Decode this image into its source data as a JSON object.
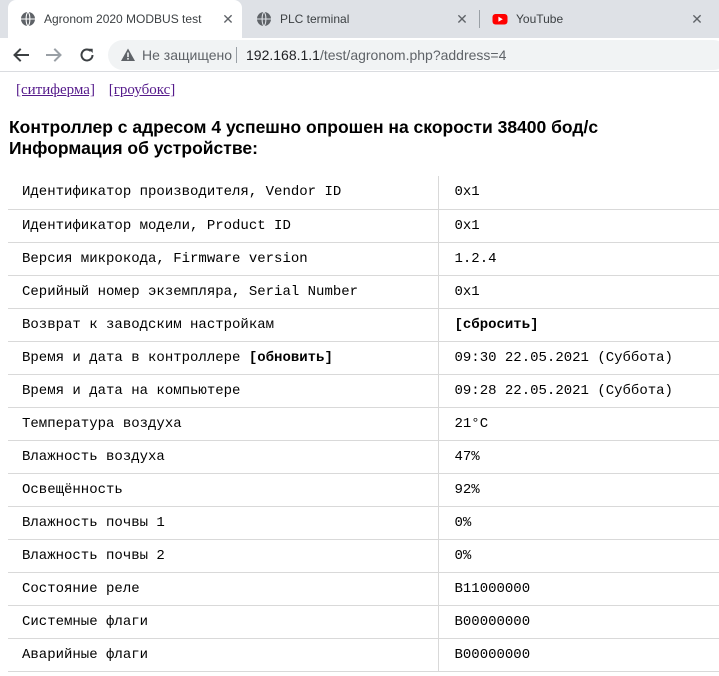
{
  "tabs": [
    {
      "title": "Agronom 2020 MODBUS test",
      "favicon": "globe-icon",
      "active": true
    },
    {
      "title": "PLC terminal",
      "favicon": "globe-icon",
      "active": false
    },
    {
      "title": "YouTube",
      "favicon": "youtube-icon",
      "active": false
    }
  ],
  "toolbar": {
    "security_label": "Не защищено",
    "url_host": "192.168.1.1",
    "url_path": "/test/agronom.php?address=4"
  },
  "nav_links": [
    "[ситиферма]",
    "[гроубокс]"
  ],
  "heading": {
    "line1": "Контроллер с адресом 4 успешно опрошен на скорости 38400 бод/с",
    "line2": "Информация об устройстве:"
  },
  "rows": [
    {
      "label": "Идентификатор производителя, Vendor ID",
      "value": "0x1"
    },
    {
      "label": "Идентификатор модели, Product ID",
      "value": "0x1"
    },
    {
      "label": "Версия микрокода, Firmware version",
      "value": "1.2.4"
    },
    {
      "label": "Серийный номер экземпляра, Serial Number",
      "value": "0x1"
    },
    {
      "label": "Возврат к заводским настройкам",
      "value": "[сбросить]"
    },
    {
      "label": "Время и дата в контроллере",
      "label_action": "[обновить]",
      "value": "09:30 22.05.2021 (Суббота)"
    },
    {
      "label": "Время и дата на компьютере",
      "value": "09:28 22.05.2021 (Суббота)"
    },
    {
      "label": "Температура воздуха",
      "value": "21°C"
    },
    {
      "label": "Влажность воздуха",
      "value": "47%"
    },
    {
      "label": "Освещённость",
      "value": "92%"
    },
    {
      "label": "Влажность почвы 1",
      "value": "0%"
    },
    {
      "label": "Влажность почвы 2",
      "value": "0%"
    },
    {
      "label": "Состояние реле",
      "value": "B11000000"
    },
    {
      "label": "Системные флаги",
      "value": "B00000000"
    },
    {
      "label": "Аварийные флаги",
      "value": "B00000000"
    }
  ],
  "colors": {
    "tabbar_bg": "#dee1e6",
    "link_visited": "#551a8b",
    "youtube_red": "#ff0000"
  }
}
